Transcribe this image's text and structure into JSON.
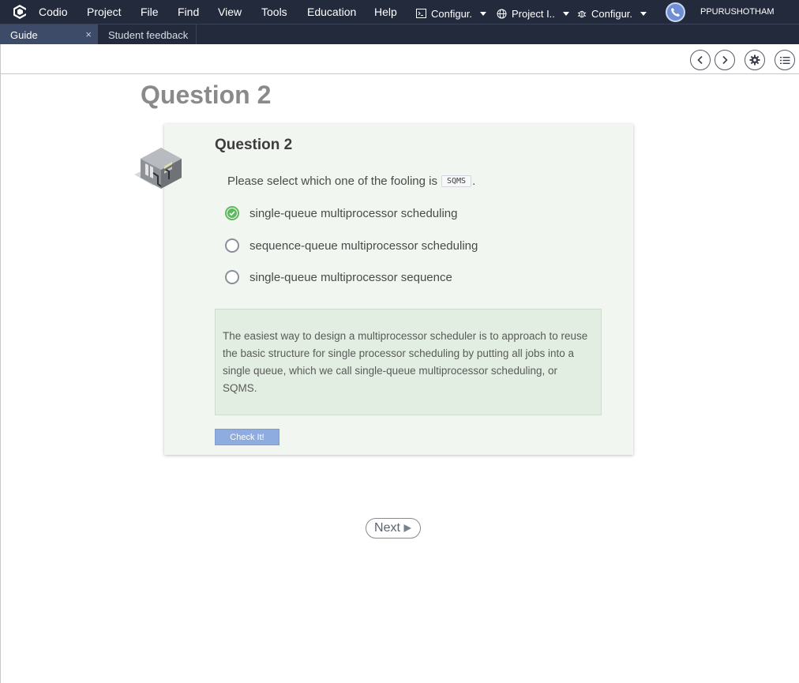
{
  "menubar": {
    "app_name": "Codio",
    "items": [
      "Project",
      "File",
      "Find",
      "View",
      "Tools",
      "Education",
      "Help"
    ],
    "dropdowns": [
      {
        "label": "Configur.",
        "icon": "terminal-icon"
      },
      {
        "label": "Project I..",
        "icon": "globe-icon"
      },
      {
        "label": "Configur.",
        "icon": "bug-icon"
      }
    ],
    "username": "PPURUSHOTHAM"
  },
  "tabs": [
    {
      "label": "Guide",
      "active": true,
      "close": "×"
    },
    {
      "label": "Student feedback",
      "active": false
    }
  ],
  "page": {
    "title": "Question 2"
  },
  "question": {
    "title": "Question 2",
    "prompt": "Please select which one of the fooling is",
    "prompt_code": "SQMS",
    "prompt_end": ".",
    "options": [
      {
        "label": "single-queue multiprocessor scheduling",
        "selected": true
      },
      {
        "label": "sequence-queue multiprocessor scheduling",
        "selected": false
      },
      {
        "label": "single-queue multiprocessor sequence",
        "selected": false
      }
    ],
    "explanation": "The easiest way to design a multiprocessor scheduler is to approach to reuse the basic structure for single processor scheduling by putting all jobs into a single queue, which we call single-queue multiprocessor scheduling, or SQMS.",
    "check_label": "Check It!"
  },
  "navigation": {
    "next_label": "Next"
  },
  "colors": {
    "menubar_bg": "#232a3b",
    "active_tab_bg": "#3d4a68",
    "card_bg": "#f1f6f1",
    "explanation_bg": "#e2eee1",
    "check_button": "#8eacdf",
    "selected_radio": "#5cb85c"
  }
}
